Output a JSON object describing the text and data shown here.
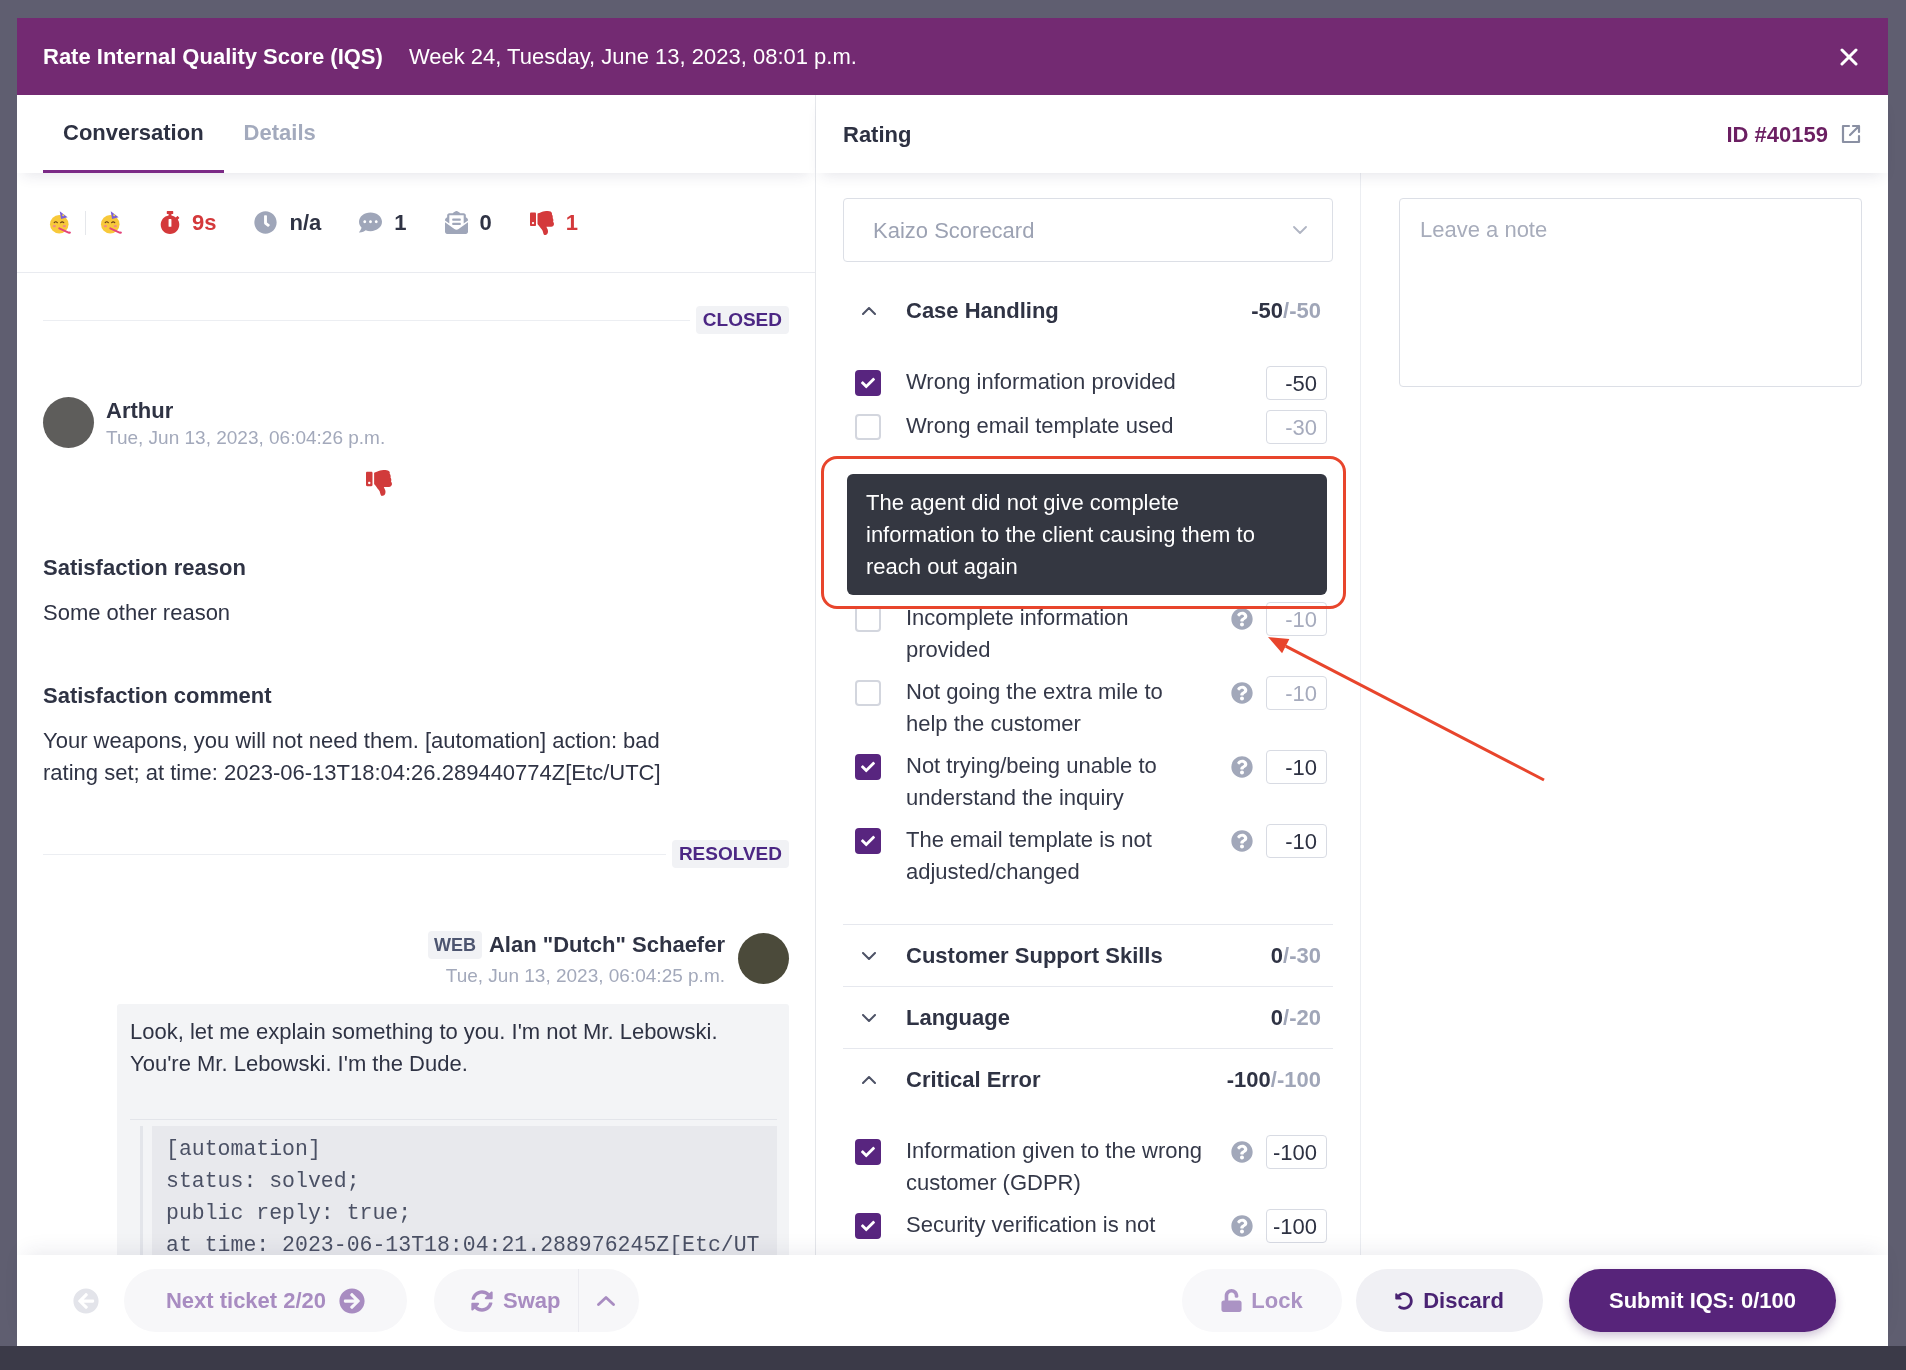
{
  "header": {
    "title": "Rate Internal Quality Score (IQS)",
    "subtitle": "Week 24, Tuesday, June 13, 2023, 08:01 p.m."
  },
  "conversation_panel": {
    "tabs": [
      {
        "label": "Conversation",
        "selected": true
      },
      {
        "label": "Details",
        "selected": false
      }
    ],
    "stats": [
      {
        "kind": "response_time",
        "value": "9s",
        "warning": true
      },
      {
        "kind": "wait_time",
        "value": "n/a",
        "warning": false
      },
      {
        "kind": "messages",
        "value": "1",
        "warning": false
      },
      {
        "kind": "replies",
        "value": "0",
        "warning": false
      },
      {
        "kind": "rating",
        "value": "1",
        "warning": true
      }
    ],
    "events": [
      {
        "kind": "status",
        "label": "CLOSED"
      },
      {
        "kind": "customer",
        "author": "Arthur",
        "time": "Tue, Jun 13, 2023, 06:04:26 p.m.",
        "negative_rating": true,
        "fields": [
          {
            "heading": "Satisfaction reason",
            "text": "Some other reason"
          },
          {
            "heading": "Satisfaction comment",
            "text": "Your weapons, you will not need them. [automation] action: bad rating set; at time: 2023-06-13T18:04:26.289440774Z[Etc/UTC]"
          }
        ]
      },
      {
        "kind": "status",
        "label": "RESOLVED"
      },
      {
        "kind": "agent",
        "channel": "WEB",
        "author": "Alan \"Dutch\" Schaefer",
        "time": "Tue, Jun 13, 2023, 06:04:25 p.m.",
        "text": "Look, let me explain something to you. I'm not Mr. Lebowski. You're Mr. Lebowski. I'm the Dude.",
        "code_lines": [
          "[automation]",
          "status: solved;",
          "public reply: true;",
          "at time: 2023-06-13T18:04:21.288976245Z[Etc/UT"
        ]
      }
    ]
  },
  "rating_panel": {
    "title": "Rating",
    "ticket_id": "ID #40159",
    "scorecard_select": {
      "placeholder": "Kaizo Scorecard"
    },
    "categories": [
      {
        "name": "Case Handling",
        "score": "-50",
        "max": "/-50",
        "expanded": true,
        "criteria": [
          {
            "label": "Wrong information provided",
            "checked": true,
            "help": false,
            "points": "-50"
          },
          {
            "label": "Wrong email template used",
            "checked": false,
            "help": false,
            "points": "-30"
          },
          {
            "label": "Incomplete information provided",
            "checked": false,
            "help": true,
            "points": "-10",
            "tooltip": "The agent did not give complete information to the client causing them to reach out again"
          },
          {
            "label": "Not going the extra mile to help the customer",
            "checked": false,
            "help": true,
            "points": "-10"
          },
          {
            "label": "Not trying/being unable to understand the inquiry",
            "checked": true,
            "help": true,
            "points": "-10"
          },
          {
            "label": "The email template is not adjusted/changed",
            "checked": true,
            "help": true,
            "points": "-10"
          }
        ]
      },
      {
        "name": "Customer Support Skills",
        "score": "0",
        "max": "/-30",
        "expanded": false
      },
      {
        "name": "Language",
        "score": "0",
        "max": "/-20",
        "expanded": false
      },
      {
        "name": "Critical Error",
        "score": "-100",
        "max": "/-100",
        "expanded": true,
        "criteria": [
          {
            "label": "Information given to the wrong customer (GDPR)",
            "checked": true,
            "help": true,
            "points": "-100"
          },
          {
            "label": "Security verification is not",
            "checked": true,
            "help": true,
            "points": "-100"
          }
        ]
      }
    ],
    "note": {
      "placeholder": "Leave a note"
    }
  },
  "footer": {
    "previous": {
      "disabled": true
    },
    "next_ticket": {
      "label": "Next ticket 2/20",
      "disabled": true
    },
    "swap": {
      "label": "Swap",
      "disabled": true
    },
    "lock": {
      "label": "Lock",
      "disabled": true
    },
    "discard": {
      "label": "Discard",
      "disabled": false
    },
    "submit": {
      "label": "Submit IQS: 0/100"
    }
  }
}
